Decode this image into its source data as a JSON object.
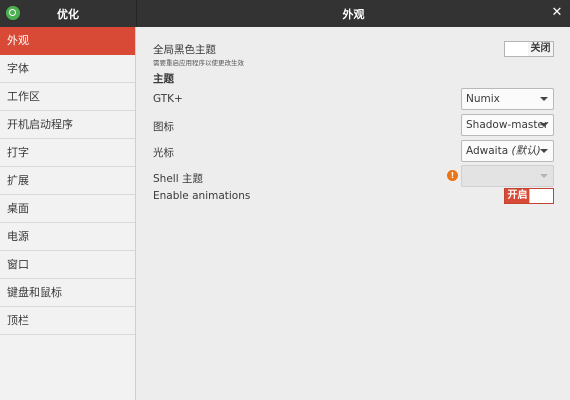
{
  "app": {
    "title": "优化",
    "window_title": "外观",
    "close_glyph": "✕"
  },
  "sidebar": {
    "items": [
      {
        "label": "外观"
      },
      {
        "label": "字体"
      },
      {
        "label": "工作区"
      },
      {
        "label": "开机启动程序"
      },
      {
        "label": "打字"
      },
      {
        "label": "扩展"
      },
      {
        "label": "桌面"
      },
      {
        "label": "电源"
      },
      {
        "label": "窗口"
      },
      {
        "label": "键盘和鼠标"
      },
      {
        "label": "顶栏"
      }
    ]
  },
  "main": {
    "global_dark": {
      "label": "全局黑色主题",
      "sublabel": "需要重启应用程序以使更改生效",
      "toggle_text": "关闭",
      "state": "off"
    },
    "themes_header": "主题",
    "gtk": {
      "label": "GTK+",
      "value": "Numix"
    },
    "icons": {
      "label": "图标",
      "value": "Shadow-master"
    },
    "cursor": {
      "label": "光标",
      "value": "Adwaita",
      "value_note": "(默认)"
    },
    "shell": {
      "label": "Shell 主题",
      "value": "",
      "warning_icon": "warning-icon"
    },
    "animations": {
      "label": "Enable animations",
      "toggle_text": "开启",
      "state": "on"
    }
  },
  "colors": {
    "accent": "#d94a36",
    "titlebar": "#333333",
    "warning": "#ec7418"
  }
}
